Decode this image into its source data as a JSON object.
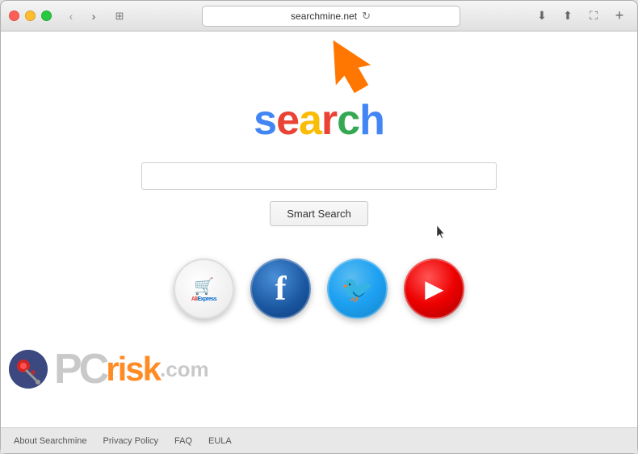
{
  "browser": {
    "url": "searchmine.net",
    "nav": {
      "back": "‹",
      "forward": "›",
      "reader": "⊞"
    },
    "toolbar_icons": [
      "⬇",
      "⬆",
      "⛶"
    ],
    "plus": "+"
  },
  "page": {
    "logo_letters": [
      {
        "char": "s",
        "class": "logo-s"
      },
      {
        "char": "e",
        "class": "logo-e"
      },
      {
        "char": "a",
        "class": "logo-a"
      },
      {
        "char": "r",
        "class": "logo-r"
      },
      {
        "char": "c",
        "class": "logo-c"
      },
      {
        "char": "h",
        "class": "logo-h"
      }
    ],
    "search_placeholder": "",
    "search_button_label": "Smart Search",
    "social_icons": [
      {
        "name": "aliexpress",
        "label": "AliExpress"
      },
      {
        "name": "facebook",
        "label": "Facebook"
      },
      {
        "name": "twitter",
        "label": "Twitter"
      },
      {
        "name": "youtube",
        "label": "YouTube"
      }
    ]
  },
  "footer": {
    "links": [
      "About Searchmine",
      "Privacy Policy",
      "FAQ",
      "EULA"
    ]
  },
  "watermark": {
    "pc": "PC",
    "risk": "risk",
    "com": ".com"
  }
}
